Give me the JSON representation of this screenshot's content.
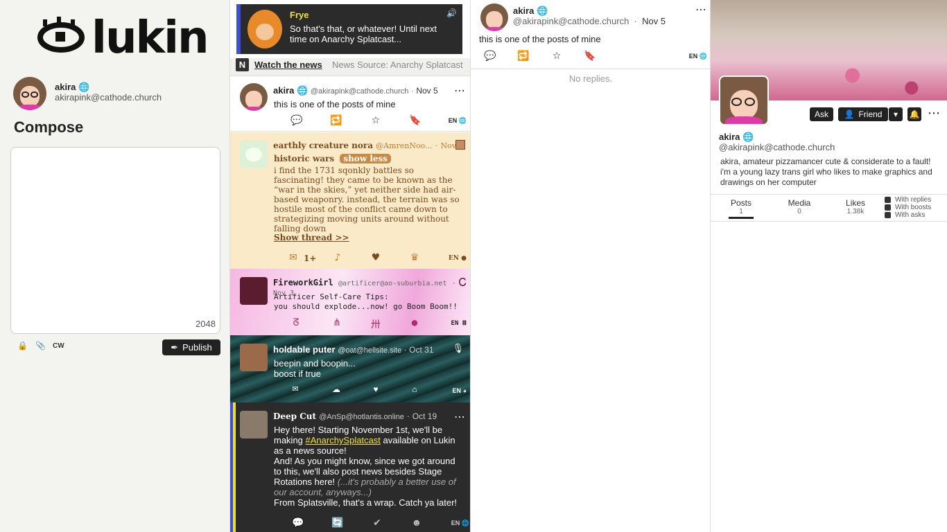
{
  "brand": {
    "logo_text": "lukin"
  },
  "me": {
    "name": "akira",
    "handle": "akirapink@cathode.church"
  },
  "compose": {
    "title": "Compose",
    "char_count": "2048",
    "cw_label": "CW",
    "publish_label": "Publish"
  },
  "news": {
    "speaker": "Frye",
    "text": "So that's that, or whatever! Until next time on Anarchy Splatcast...",
    "badge": "N",
    "watch_label": "Watch the news",
    "source": "News Source: Anarchy Splatcast"
  },
  "feed": [
    {
      "name": "akira",
      "handle": "@akirapink@cathode.church",
      "date": "Nov 5",
      "body": "this is one of the posts of mine",
      "lang": "EN"
    },
    {
      "name": "earthly creature nora",
      "handle": "@AmrenNoo...",
      "date": "Nov 3",
      "title": "historic wars",
      "show_less": "show less",
      "body": "i find the 1731 sqonkly battles so fascinating! they came to be known as the “war in the skies,” yet neither side had air-based weaponry. instead, the terrain was so hostile most of the conflict came down to strategizing moving units around without falling down",
      "show_thread": "Show thread >>",
      "reply_count": "1+",
      "lang": "EN"
    },
    {
      "name": "FireworkGirl",
      "handle": "@artificer@ao-suburbia.net",
      "date": "Nov 3",
      "body_line1": "Artificer Self-Care Tips:",
      "body_line2": "you should explode...now! go Boom Boom!!",
      "lang": "EN"
    },
    {
      "name": "holdable puter",
      "handle": "@oat@hellsite.site",
      "date": "Oct 31",
      "body_line1": "beepin and boopin...",
      "body_line2": "boost if true",
      "lang": "EN"
    },
    {
      "name": "Deep Cut",
      "handle": "@AnSp@hotlantis.online",
      "date": "Oct 19",
      "p1_a": "Hey there! Starting November 1st, we'll be making ",
      "hashtag": "#AnarchySplatcast",
      "p1_b": " available on Lukin as a news source!",
      "p2_a": "And! As you might know, since we got around to this, we'll also post news besides Stage Rotations here! ",
      "p2_italic": "(...it's probably a better use of our account, anyways...)",
      "p3": "From Splatsville, that's a wrap. Catch ya later!",
      "lang": "EN"
    }
  ],
  "thread": {
    "name": "akira",
    "handle": "@akirapink@cathode.church",
    "date": "Nov 5",
    "body": "this is one of the posts of mine",
    "lang": "EN",
    "no_replies": "No replies."
  },
  "profile": {
    "name": "akira",
    "handle": "@akirapink@cathode.church",
    "bio": "akira, amateur pizzamancer cute & considerate to a fault! i'm a young lazy trans girl who likes to make graphics and drawings on her computer",
    "ask_label": "Ask",
    "friend_label": "Friend",
    "tabs": [
      {
        "label": "Posts",
        "count": "1"
      },
      {
        "label": "Media",
        "count": "0"
      },
      {
        "label": "Likes",
        "count": "1.38k"
      }
    ],
    "filters": [
      "With replies",
      "With boosts",
      "With asks"
    ]
  },
  "colors": {
    "news_accent": "#3e4fd6",
    "deepcut_accent": "#e8e030",
    "nora_bg": "#fbeac7",
    "firework_bg": "#f3b5df",
    "holdable_bg": "#1f4a4a"
  }
}
